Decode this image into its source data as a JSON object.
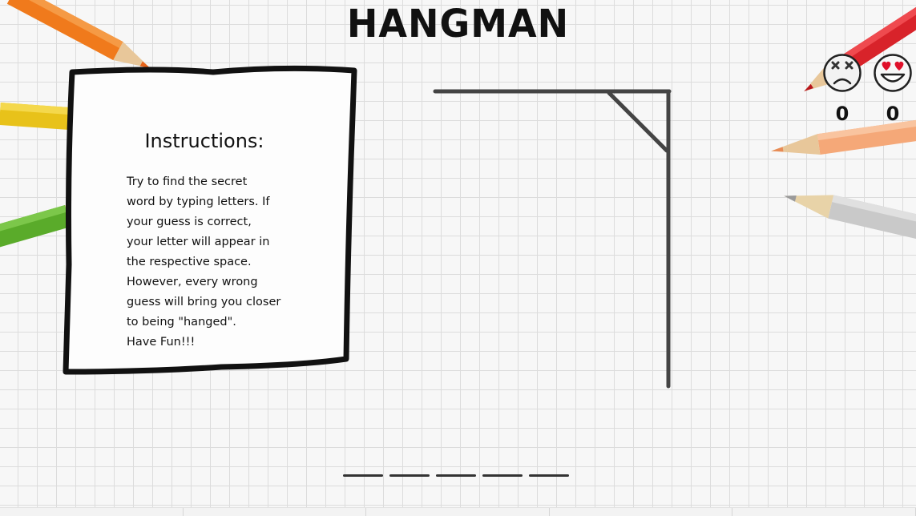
{
  "game": {
    "title": "HANGMAN"
  },
  "instructions": {
    "heading": "Instructions:",
    "body": "Try to find the secret\nword by typing letters. If\nyour guess is correct,\nyour letter will appear in\nthe respective space.\nHowever, every wrong\nguess will bring you closer\nto being \"hanged\".\nHave Fun!!!"
  },
  "scores": {
    "losses": {
      "icon": "dead-face-icon",
      "count": "0"
    },
    "wins": {
      "icon": "heart-eyes-face-icon",
      "count": "0"
    }
  },
  "word": {
    "slot_count": 5
  },
  "colors": {
    "ink": "#111111",
    "gallows": "#444444",
    "paper": "#f7f7f7",
    "grid": "#dcdcdc",
    "heart": "#e0102a"
  }
}
